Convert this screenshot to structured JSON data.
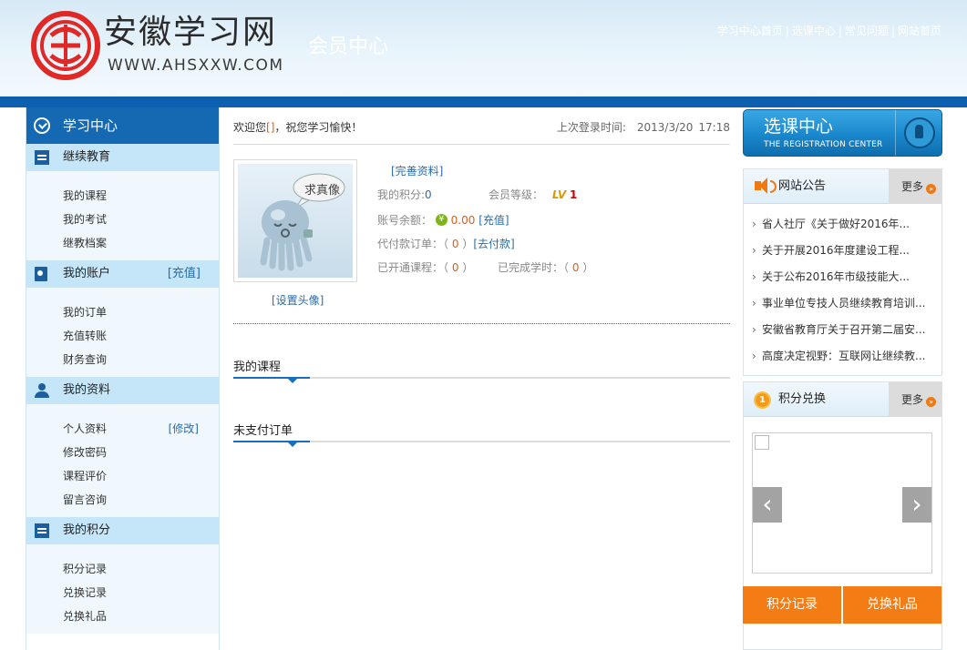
{
  "header": {
    "site_name": "安徽学习网",
    "site_domain": "WWW.AHSXXW.COM",
    "section_title": "会员中心",
    "nav": [
      "学习中心首页",
      "选课中心",
      "常见问题",
      "网站首页"
    ]
  },
  "sidebar": {
    "title": "学习中心",
    "sections": [
      {
        "title": "继续教育",
        "link": "",
        "items": [
          {
            "label": "我的课程"
          },
          {
            "label": "我的考试"
          },
          {
            "label": "继教档案"
          }
        ]
      },
      {
        "title": "我的账户",
        "link": "[充值]",
        "items": [
          {
            "label": "我的订单"
          },
          {
            "label": "充值转账"
          },
          {
            "label": "财务查询"
          }
        ]
      },
      {
        "title": "我的资料",
        "link": "",
        "items": [
          {
            "label": "个人资料",
            "link": "[修改]"
          },
          {
            "label": "修改密码"
          },
          {
            "label": "课程评价"
          },
          {
            "label": "留言咨询"
          }
        ]
      },
      {
        "title": "我的积分",
        "link": "",
        "items": [
          {
            "label": "积分记录"
          },
          {
            "label": "兑换记录"
          },
          {
            "label": "兑换礼品"
          }
        ]
      }
    ]
  },
  "main": {
    "welcome_prefix": "欢迎您",
    "welcome_bracket": "[]",
    "welcome_suffix": "，祝您学习愉快！",
    "last_login_label": "上次登录时间:",
    "last_login_date": "2013/3/20",
    "last_login_time": "17:18",
    "avatar_bubble": "求真像",
    "set_avatar": "[设置头像]",
    "complete_profile": "[完善资料]",
    "points_label": "我的积分:",
    "points_value": "0",
    "level_label": "会员等级：",
    "level_badge": "LV",
    "level_value": "1",
    "balance_label": "账号余额：",
    "coin_symbol": "¥",
    "balance_value": "0.00",
    "recharge_link": "[充值]",
    "pending_label": "代付款订单：（",
    "pending_value": "0",
    "pending_close": "）",
    "pay_link": "[去付款]",
    "opened_label": "已开通课程：（",
    "opened_value": "0",
    "opened_close": "）",
    "hours_label": "已完成学时：（",
    "hours_value": "0",
    "hours_close": "）",
    "tab_courses": "我的课程",
    "tab_unpaid": "未支付订单"
  },
  "right": {
    "reg_cn": "选课中心",
    "reg_en": "THE REGISTRATION CENTER",
    "notice_title": "网站公告",
    "more": "更多",
    "more_arrow": "»",
    "notices": [
      "省人社厅《关于做好2016年...",
      "关于开展2016年度建设工程...",
      "关于公布2016年市级技能大...",
      "事业单位专技人员继续教育培训...",
      "安徽省教育厅关于召开第二届安...",
      "高度决定视野：互联网让继续教..."
    ],
    "exchange_title": "积分兑换",
    "medal": "1",
    "prev_arrow": "‹",
    "next_arrow": "›",
    "btn_points_record": "积分记录",
    "btn_exchange_gift": "兑换礼品"
  },
  "colors": {
    "brand_blue": "#1569b3",
    "band_blue": "#0d5fb0",
    "section_bg": "#c5e5f8",
    "accent_orange": "#f37d14",
    "link_blue": "#2a6ca8"
  }
}
